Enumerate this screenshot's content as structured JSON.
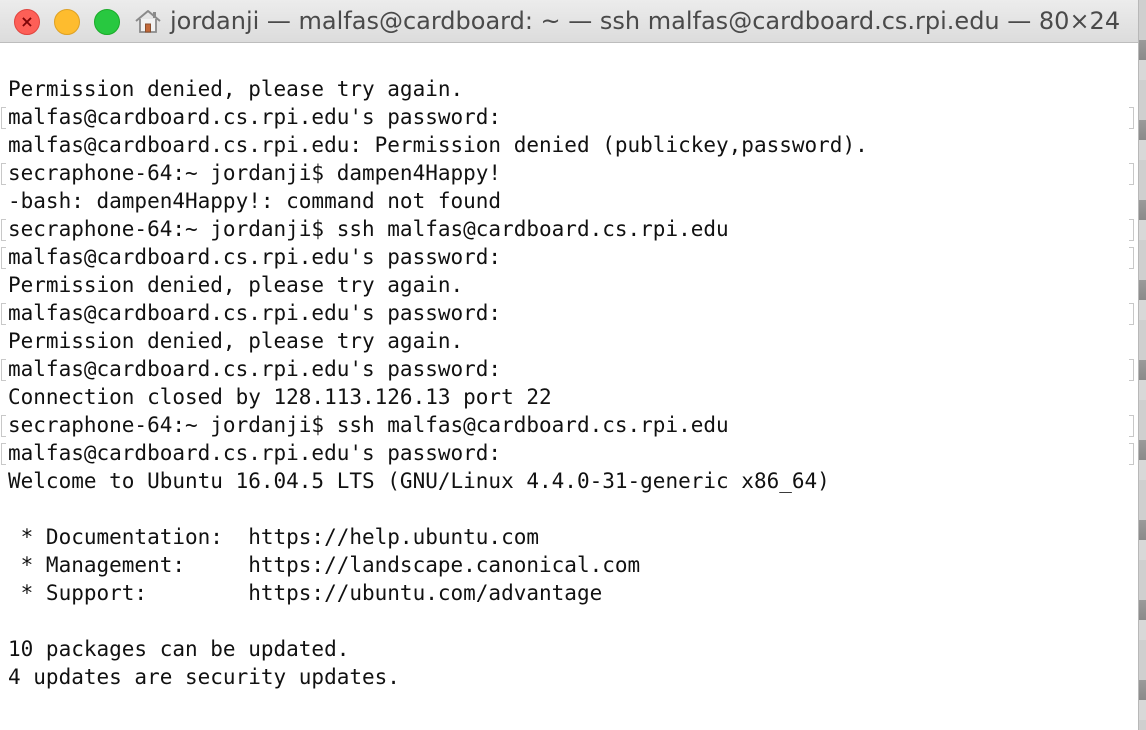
{
  "window": {
    "title": "jordanji — malfas@cardboard: ~ — ssh malfas@cardboard.cs.rpi.edu — 80×24",
    "close_glyph": "×"
  },
  "icons": {
    "close": "close-icon",
    "minimize": "minimize-icon",
    "maximize": "maximize-icon",
    "home": "home-icon"
  },
  "colors": {
    "close": "#fd5f57",
    "minimize": "#febc2e",
    "maximize": "#28c840",
    "terminal_bg": "#ffffff",
    "terminal_fg": "#111111"
  },
  "terminal": {
    "lines": [
      "Permission denied, please try again.",
      "malfas@cardboard.cs.rpi.edu's password:",
      "malfas@cardboard.cs.rpi.edu: Permission denied (publickey,password).",
      "secraphone-64:~ jordanji$ dampen4Happy!",
      "-bash: dampen4Happy!: command not found",
      "secraphone-64:~ jordanji$ ssh malfas@cardboard.cs.rpi.edu",
      "malfas@cardboard.cs.rpi.edu's password:",
      "Permission denied, please try again.",
      "malfas@cardboard.cs.rpi.edu's password:",
      "Permission denied, please try again.",
      "malfas@cardboard.cs.rpi.edu's password:",
      "Connection closed by 128.113.126.13 port 22",
      "secraphone-64:~ jordanji$ ssh malfas@cardboard.cs.rpi.edu",
      "malfas@cardboard.cs.rpi.edu's password:",
      "Welcome to Ubuntu 16.04.5 LTS (GNU/Linux 4.4.0-31-generic x86_64)",
      "",
      " * Documentation:  https://help.ubuntu.com",
      " * Management:     https://landscape.canonical.com",
      " * Support:        https://ubuntu.com/advantage",
      "",
      "10 packages can be updated.",
      "4 updates are security updates."
    ]
  }
}
